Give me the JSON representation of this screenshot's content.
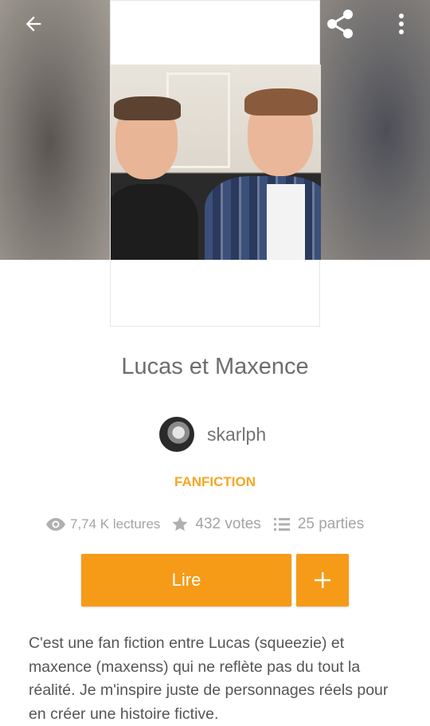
{
  "header": {
    "back_icon": "arrow-left-icon",
    "share_icon": "share-icon",
    "more_icon": "more-vertical-icon"
  },
  "story": {
    "title": "Lucas et Maxence",
    "author": "skarlph",
    "category": "FANFICTION",
    "stats": {
      "reads": "7,74 K lectures",
      "votes": "432 votes",
      "parts": "25 parties"
    },
    "read_button": "Lire",
    "add_button": "+",
    "description": "C'est une fan fiction entre Lucas (squeezie) et maxence (maxenss) qui ne reflète pas du tout la réalité. Je m'inspire juste de personnages réels pour en créer une histoire fictive."
  },
  "colors": {
    "accent": "#f59b18",
    "category": "#f5a623",
    "title_text": "#6d6d6d",
    "stats_text": "#a4a4a4"
  }
}
